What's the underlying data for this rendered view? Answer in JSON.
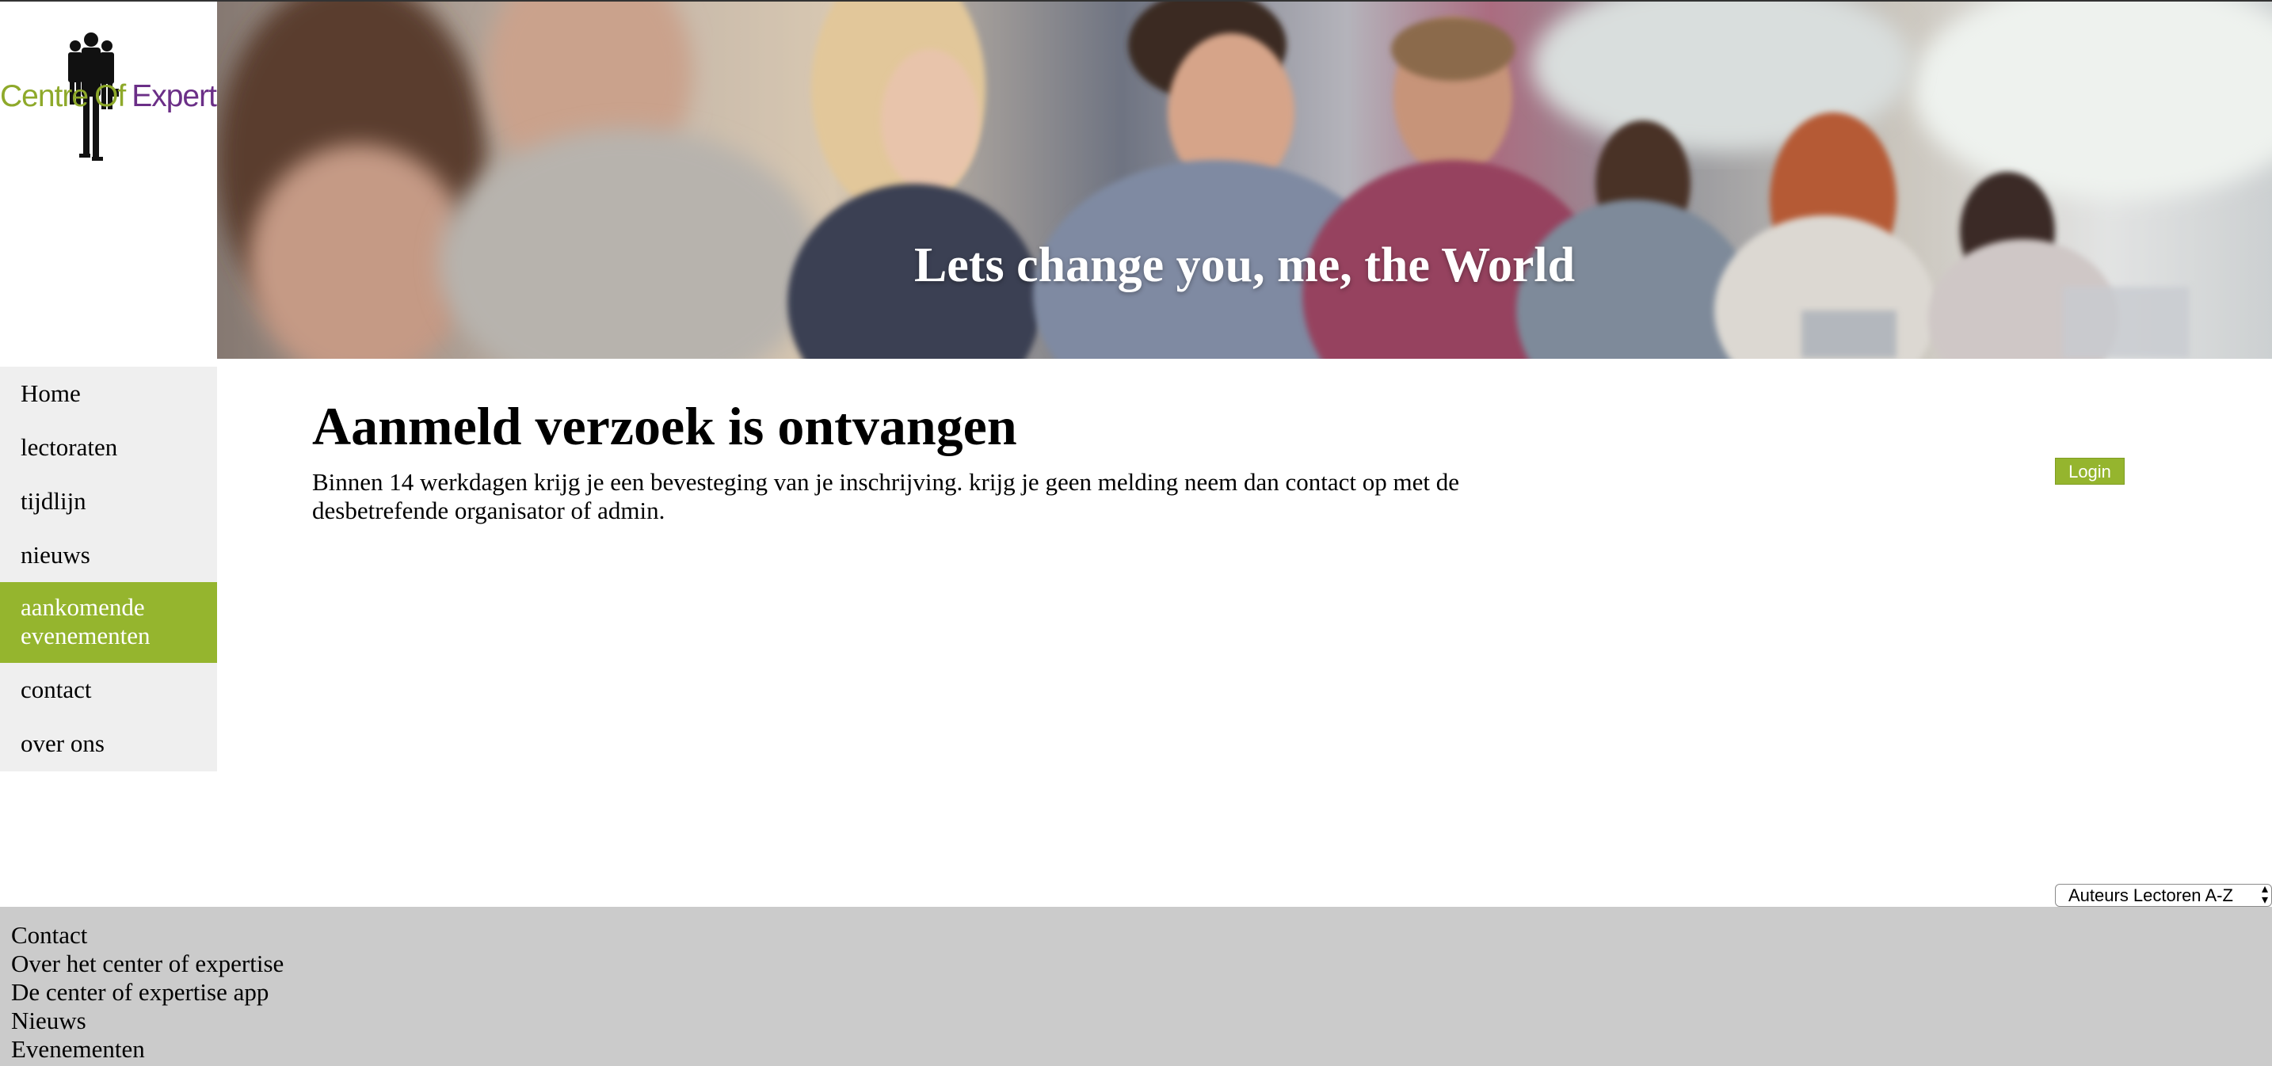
{
  "brand": {
    "logo_word_1": "Centre",
    "logo_word_2": "Of",
    "logo_word_3": "Expertise",
    "colors": {
      "green": "#8ea92a",
      "purple": "#6b2f87",
      "accent": "#95b52e"
    }
  },
  "hero": {
    "slogan": "Lets change you, me, the World"
  },
  "sidenav": {
    "items": [
      {
        "label": "Home"
      },
      {
        "label": "lectoraten"
      },
      {
        "label": "tijdlijn"
      },
      {
        "label": "nieuws"
      },
      {
        "label": "aankomende evenementen",
        "active": true
      },
      {
        "label": "contact"
      },
      {
        "label": "over ons"
      }
    ]
  },
  "main": {
    "title": "Aanmeld verzoek is ontvangen",
    "text": "Binnen 14 werkdagen krijg je een bevesteging van je inschrijving. krijg je geen melding neem dan contact op met de desbetrefende organisator of admin."
  },
  "login": {
    "label": "Login"
  },
  "sort_select": {
    "selected": "Auteurs Lectoren A-Z"
  },
  "footer": {
    "links": [
      "Contact",
      "Over het center of expertise",
      "De center of expertise app",
      "Nieuws",
      "Evenementen"
    ]
  }
}
